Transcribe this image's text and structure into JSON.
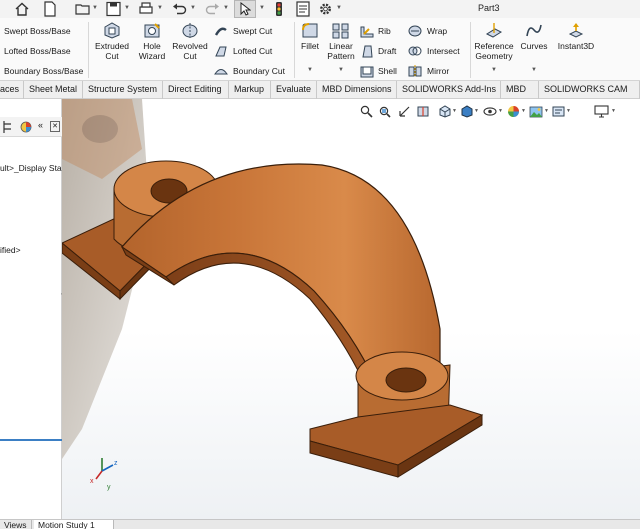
{
  "document": {
    "title": "Part3"
  },
  "quick_access": {
    "icons": [
      "home-icon",
      "new-document-icon",
      "open-folder-icon",
      "save-icon",
      "print-icon",
      "undo-icon",
      "redo-icon",
      "select-arrow-icon",
      "rebuild-traffic-light-icon",
      "file-properties-icon",
      "options-gear-icon"
    ]
  },
  "ribbon": {
    "boss_group": {
      "swept_boss": "Swept Boss/Base",
      "lofted_boss": "Lofted Boss/Base",
      "boundary_boss": "Boundary Boss/Base"
    },
    "extruded_cut": {
      "line1": "Extruded",
      "line2": "Cut"
    },
    "hole_wizard": {
      "line1": "Hole",
      "line2": "Wizard"
    },
    "revolved_cut": {
      "line1": "Revolved",
      "line2": "Cut"
    },
    "cut_group": {
      "swept_cut": "Swept Cut",
      "lofted_cut": "Lofted Cut",
      "boundary_cut": "Boundary Cut"
    },
    "fillet": "Fillet",
    "linear_pattern": {
      "line1": "Linear",
      "line2": "Pattern"
    },
    "features_col": {
      "rib": "Rib",
      "draft": "Draft",
      "shell": "Shell"
    },
    "features_col2": {
      "wrap": "Wrap",
      "intersect": "Intersect",
      "mirror": "Mirror"
    },
    "reference_geometry": {
      "line1": "Reference",
      "line2": "Geometry"
    },
    "curves": "Curves",
    "instant3d": "Instant3D"
  },
  "tabs": [
    "aces",
    "Sheet Metal",
    "Structure System",
    "Direct Editing",
    "Markup",
    "Evaluate",
    "MBD Dimensions",
    "SOLIDWORKS Add-Ins",
    "MBD",
    "SOLIDWORKS CAM"
  ],
  "feature_manager": {
    "line1": "ult>_Display Sta",
    "line2": "ified>",
    "collapse_marker": "‹"
  },
  "heads_up_icons": [
    "zoom-to-fit-icon",
    "zoom-area-icon",
    "previous-view-icon",
    "section-view-icon",
    "view-orientation-icon",
    "display-style-icon",
    "hide-show-items-icon",
    "edit-appearance-icon",
    "apply-scene-icon",
    "view-settings-icon",
    "display-pane-icon"
  ],
  "triad": {
    "x": "x",
    "y": "y",
    "z": "z"
  },
  "bottom_tabs": [
    "Views",
    "Motion Study 1"
  ],
  "colors": {
    "part_base": "#c8743a",
    "part_light": "#e39c5e",
    "part_dark": "#8a4a1f",
    "accent_blue": "#3b7fc4"
  }
}
